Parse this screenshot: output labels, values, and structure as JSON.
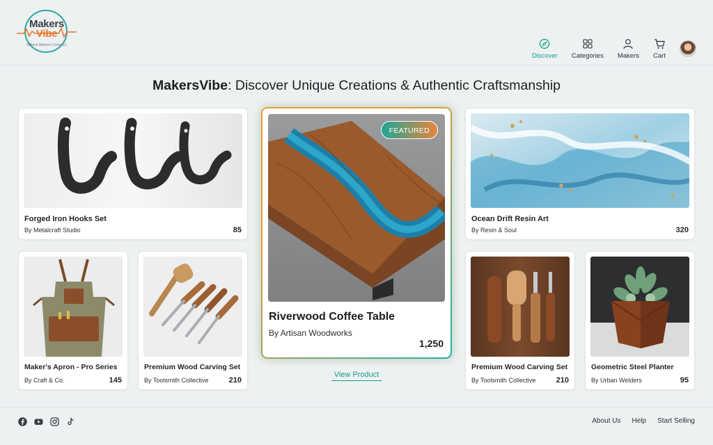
{
  "brand": {
    "logo_part1": "Makers",
    "logo_part2": "Vibe",
    "logo_tagline": "Where Makers Connect"
  },
  "nav": {
    "items": [
      {
        "label": "Discover",
        "icon": "compass-icon",
        "active": true
      },
      {
        "label": "Categories",
        "icon": "grid-icon",
        "active": false
      },
      {
        "label": "Makers",
        "icon": "user-icon",
        "active": false
      },
      {
        "label": "Cart",
        "icon": "cart-icon",
        "active": false
      }
    ]
  },
  "page": {
    "title_brand": "MakersVibe",
    "title_rest": ": Discover Unique Creations & Authentic Craftsmanship"
  },
  "products": {
    "iron_hooks": {
      "name": "Forged Iron Hooks Set",
      "by": "By Metalcraft Studio",
      "price": "85"
    },
    "resin_art": {
      "name": "Ocean Drift Resin Art",
      "by": "By Resin & Soul",
      "price": "320"
    },
    "apron": {
      "name": "Maker's Apron - Pro Series",
      "by": "By Craft & Co.",
      "price": "145"
    },
    "carving_set_a": {
      "name": "Premium Wood Carving Set",
      "by": "By Toolsmith Collective",
      "price": "210"
    },
    "carving_set_b": {
      "name": "Premium Wood Carving Set",
      "by": "By Toolsmith Collective",
      "price": "210"
    },
    "planter": {
      "name": "Geometric Steel Planter",
      "by": "By Urban Welders",
      "price": "95"
    }
  },
  "featured": {
    "badge": "FEATURED",
    "name": "Riverwood Coffee Table",
    "by": "By Artisan Woodworks",
    "price": "1,250",
    "cta": "View Product"
  },
  "footer": {
    "social": [
      "facebook-icon",
      "youtube-icon",
      "instagram-icon",
      "tiktok-icon"
    ],
    "links": [
      "About Us",
      "Help",
      "Start Selling"
    ]
  },
  "colors": {
    "accent_teal": "#1a9a8f",
    "accent_orange": "#f29a38",
    "background": "#eef1f2"
  }
}
